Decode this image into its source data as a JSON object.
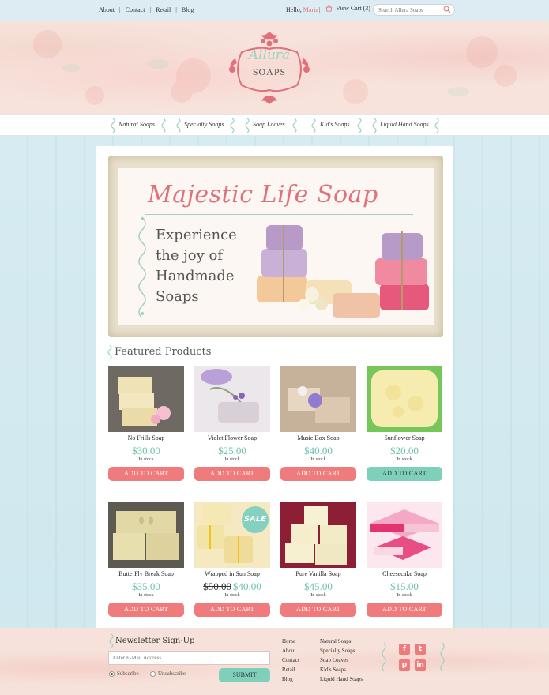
{
  "topbar": {
    "links": [
      "About",
      "Contact",
      "Retail",
      "Blog"
    ],
    "hello": "Hello,",
    "user": "Maria",
    "cart": "View Cart (3)",
    "search_placeholder": "Search Allura Soaps"
  },
  "logo": {
    "line1": "Allura",
    "line2": "SOAPS"
  },
  "nav": [
    "Natural Soaps",
    "Specialty Soaps",
    "Soap Loaves",
    "Kid's Soaps",
    "Liquid Hand Soaps"
  ],
  "banner": {
    "title": "Majestic Life Soap",
    "subtitle_lines": [
      "Experience",
      "the joy of",
      "Handmade",
      "Soaps"
    ]
  },
  "featured_title": "Featured Products",
  "products": [
    {
      "name": "No Frills Soap",
      "price": "$30.00",
      "old_price": "",
      "stock": "In stock",
      "button": "ADD TO CART",
      "highlight": false,
      "sale": ""
    },
    {
      "name": "Violet Flower Soap",
      "price": "$25.00",
      "old_price": "",
      "stock": "In stock",
      "button": "ADD TO CART",
      "highlight": false,
      "sale": ""
    },
    {
      "name": "Music Box Soap",
      "price": "$40.00",
      "old_price": "",
      "stock": "In stock",
      "button": "ADD TO CART",
      "highlight": false,
      "sale": ""
    },
    {
      "name": "Sunflower Soap",
      "price": "$20.00",
      "old_price": "",
      "stock": "In stock",
      "button": "ADD TO CART",
      "highlight": true,
      "sale": ""
    },
    {
      "name": "ButterFly Break Soap",
      "price": "$35.00",
      "old_price": "",
      "stock": "In stock",
      "button": "ADD TO CART",
      "highlight": false,
      "sale": ""
    },
    {
      "name": "Wrapped in Sun Soap",
      "price": "$40.00",
      "old_price": "$50.00",
      "stock": "In stock",
      "button": "ADD TO CART",
      "highlight": false,
      "sale": "SALE"
    },
    {
      "name": "Pure Vanilla Soap",
      "price": "$45.00",
      "old_price": "",
      "stock": "In stock",
      "button": "ADD TO CART",
      "highlight": false,
      "sale": ""
    },
    {
      "name": "Cheesecake Soap",
      "price": "$15.00",
      "old_price": "",
      "stock": "In stock",
      "button": "ADD TO CART",
      "highlight": false,
      "sale": ""
    }
  ],
  "footer": {
    "newsletter_title": "Newsletter Sign-Up",
    "email_placeholder": "Enter E-Mail Address",
    "subscribe": "Subscribe",
    "unsubscribe": "Unsubscribe",
    "submit": "SUBMIT",
    "links_col1": [
      "Home",
      "About",
      "Contact",
      "Retail",
      "Blog"
    ],
    "links_col2": [
      "Natural Soaps",
      "Specialty Soaps",
      "Soap Loaves",
      "Kid's Soaps",
      "Liquid Hand Soaps"
    ],
    "social": [
      "facebook-icon",
      "twitter-icon",
      "pinterest-icon",
      "linkedin-icon"
    ]
  },
  "colors": {
    "accent_pink": "#f07b7c",
    "accent_mint": "#7fd0bb",
    "price_green": "#6cc3ae"
  }
}
